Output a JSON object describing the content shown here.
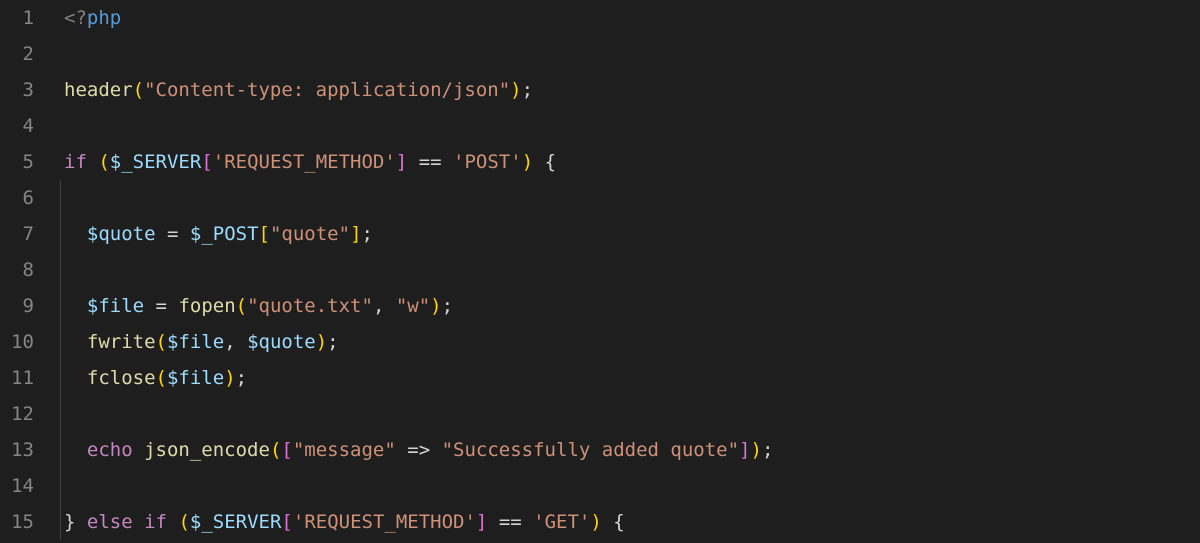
{
  "gutter": {
    "lines": [
      "1",
      "2",
      "3",
      "4",
      "5",
      "6",
      "7",
      "8",
      "9",
      "10",
      "11",
      "12",
      "13",
      "14",
      "15"
    ]
  },
  "code": {
    "l1": {
      "open": "<?",
      "php": "php"
    },
    "l3": {
      "fn": "header",
      "s": "\"Content-type: application/json\""
    },
    "l5": {
      "kw": "if",
      "var": "$_SERVER",
      "key": "'REQUEST_METHOD'",
      "op": "==",
      "val": "'POST'"
    },
    "l7": {
      "var": "$quote",
      "eq": "=",
      "post": "$_POST",
      "key": "\"quote\""
    },
    "l9": {
      "var": "$file",
      "eq": "=",
      "fn": "fopen",
      "s1": "\"quote.txt\"",
      "s2": "\"w\""
    },
    "l10": {
      "fn": "fwrite",
      "v1": "$file",
      "v2": "$quote"
    },
    "l11": {
      "fn": "fclose",
      "v1": "$file"
    },
    "l13": {
      "kw": "echo",
      "fn": "json_encode",
      "k": "\"message\"",
      "arrow": "=>",
      "v": "\"Successfully added quote\""
    },
    "l15": {
      "kw1": "else",
      "kw2": "if",
      "var": "$_SERVER",
      "key": "'REQUEST_METHOD'",
      "op": "==",
      "val": "'GET'"
    }
  }
}
